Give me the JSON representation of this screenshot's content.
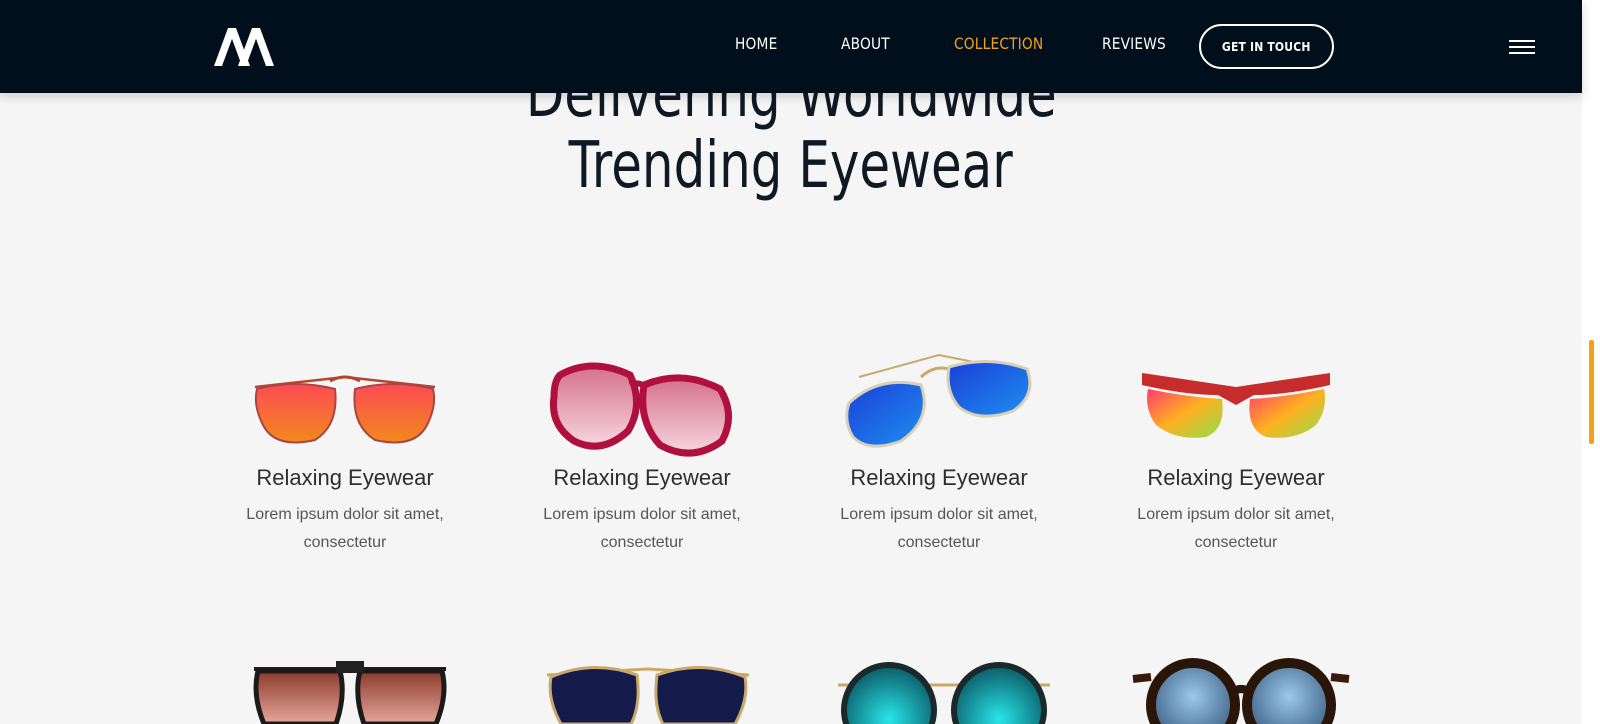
{
  "nav": {
    "links": [
      "HOME",
      "ABOUT",
      "COLLECTION",
      "REVIEWS"
    ],
    "active": "COLLECTION",
    "cta_label": "GET IN TOUCH"
  },
  "colors": {
    "header_bg": "#010e1b",
    "accent": "#f0a218",
    "page_bg": "#f5f5f5",
    "heading": "#0f1923"
  },
  "headline": {
    "line1": "Delivering Worldwide",
    "line2": "Trending Eyewear"
  },
  "products": [
    {
      "title": "Relaxing Eyewear",
      "desc_line1": "Lorem ipsum dolor sit amet,",
      "desc_line2": "consectetur",
      "icon": "orange-aviator-sunglasses"
    },
    {
      "title": "Relaxing Eyewear",
      "desc_line1": "Lorem ipsum dolor sit amet,",
      "desc_line2": "consectetur",
      "icon": "pink-oversized-sunglasses"
    },
    {
      "title": "Relaxing Eyewear",
      "desc_line1": "Lorem ipsum dolor sit amet,",
      "desc_line2": "consectetur",
      "icon": "blue-aviator-sunglasses"
    },
    {
      "title": "Relaxing Eyewear",
      "desc_line1": "Lorem ipsum dolor sit amet,",
      "desc_line2": "consectetur",
      "icon": "rainbow-sport-sunglasses"
    }
  ],
  "second_row_icons": [
    "brown-square-aviator",
    "navy-aviator",
    "teal-round-mirror",
    "blue-round-tortoise"
  ]
}
